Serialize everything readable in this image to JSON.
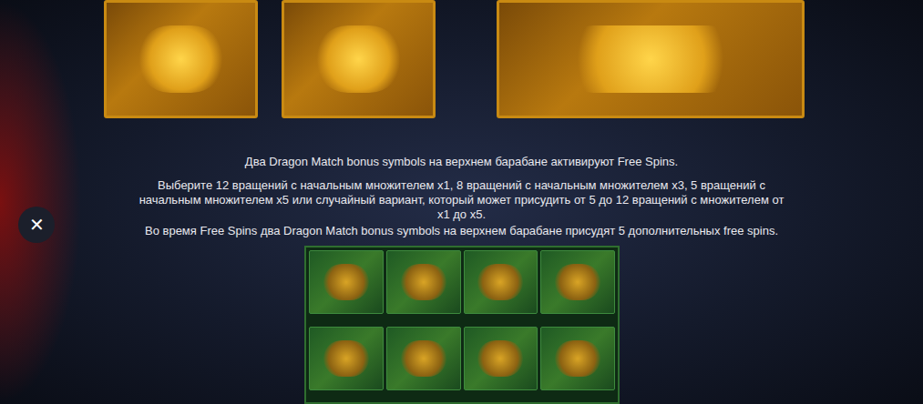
{
  "close_button": {
    "label": "✕"
  },
  "paragraphs": [
    "Два Dragon Match bonus symbols на верхнем барабане активируют Free Spins.",
    "Выберите 12 вращений с начальным множителем x1, 8 вращений с начальным множителем x3, 5 вращений с начальным множителем x5 или случайный вариант, который может присудить от 5 до 12 вращений с множителем от x1 до x5.",
    "Во время Free Spins два Dragon Match bonus symbols на верхнем барабане присудят 5 дополнительных free spins."
  ]
}
